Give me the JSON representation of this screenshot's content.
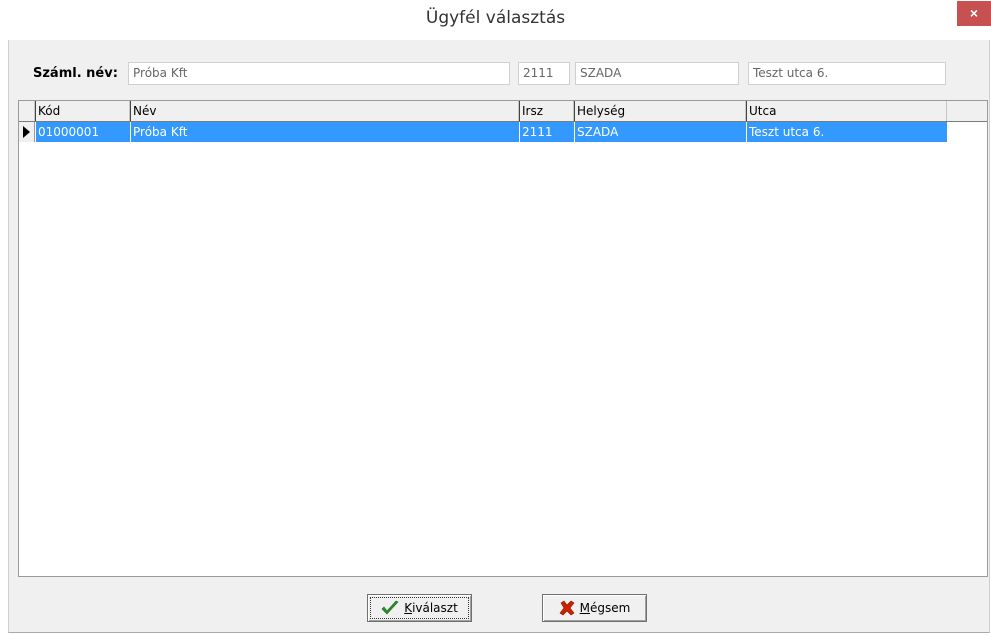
{
  "window": {
    "title": "Ügyfél választás",
    "close_glyph": "×"
  },
  "filter": {
    "label": "Száml. név:",
    "name_value": "Próba Kft",
    "zip_value": "2111",
    "city_value": "SZADA",
    "street_value": "Teszt utca 6."
  },
  "grid": {
    "columns": [
      "Kód",
      "Név",
      "Irsz",
      "Helység",
      "Utca"
    ],
    "rows": [
      {
        "kod": "01000001",
        "nev": "Próba Kft",
        "irsz": "2111",
        "helyseg": "SZADA",
        "utca": "Teszt utca 6."
      }
    ],
    "selected_row": 0,
    "selection_color": "#3399ff"
  },
  "buttons": {
    "select": {
      "access_key": "K",
      "label_rest": "iválaszt",
      "icon": "check-icon"
    },
    "cancel": {
      "access_key": "M",
      "label_rest": "égsem",
      "icon": "x-icon"
    }
  },
  "colors": {
    "close": "#c75050",
    "check": "#2e8b2e",
    "cross": "#cc2200"
  }
}
